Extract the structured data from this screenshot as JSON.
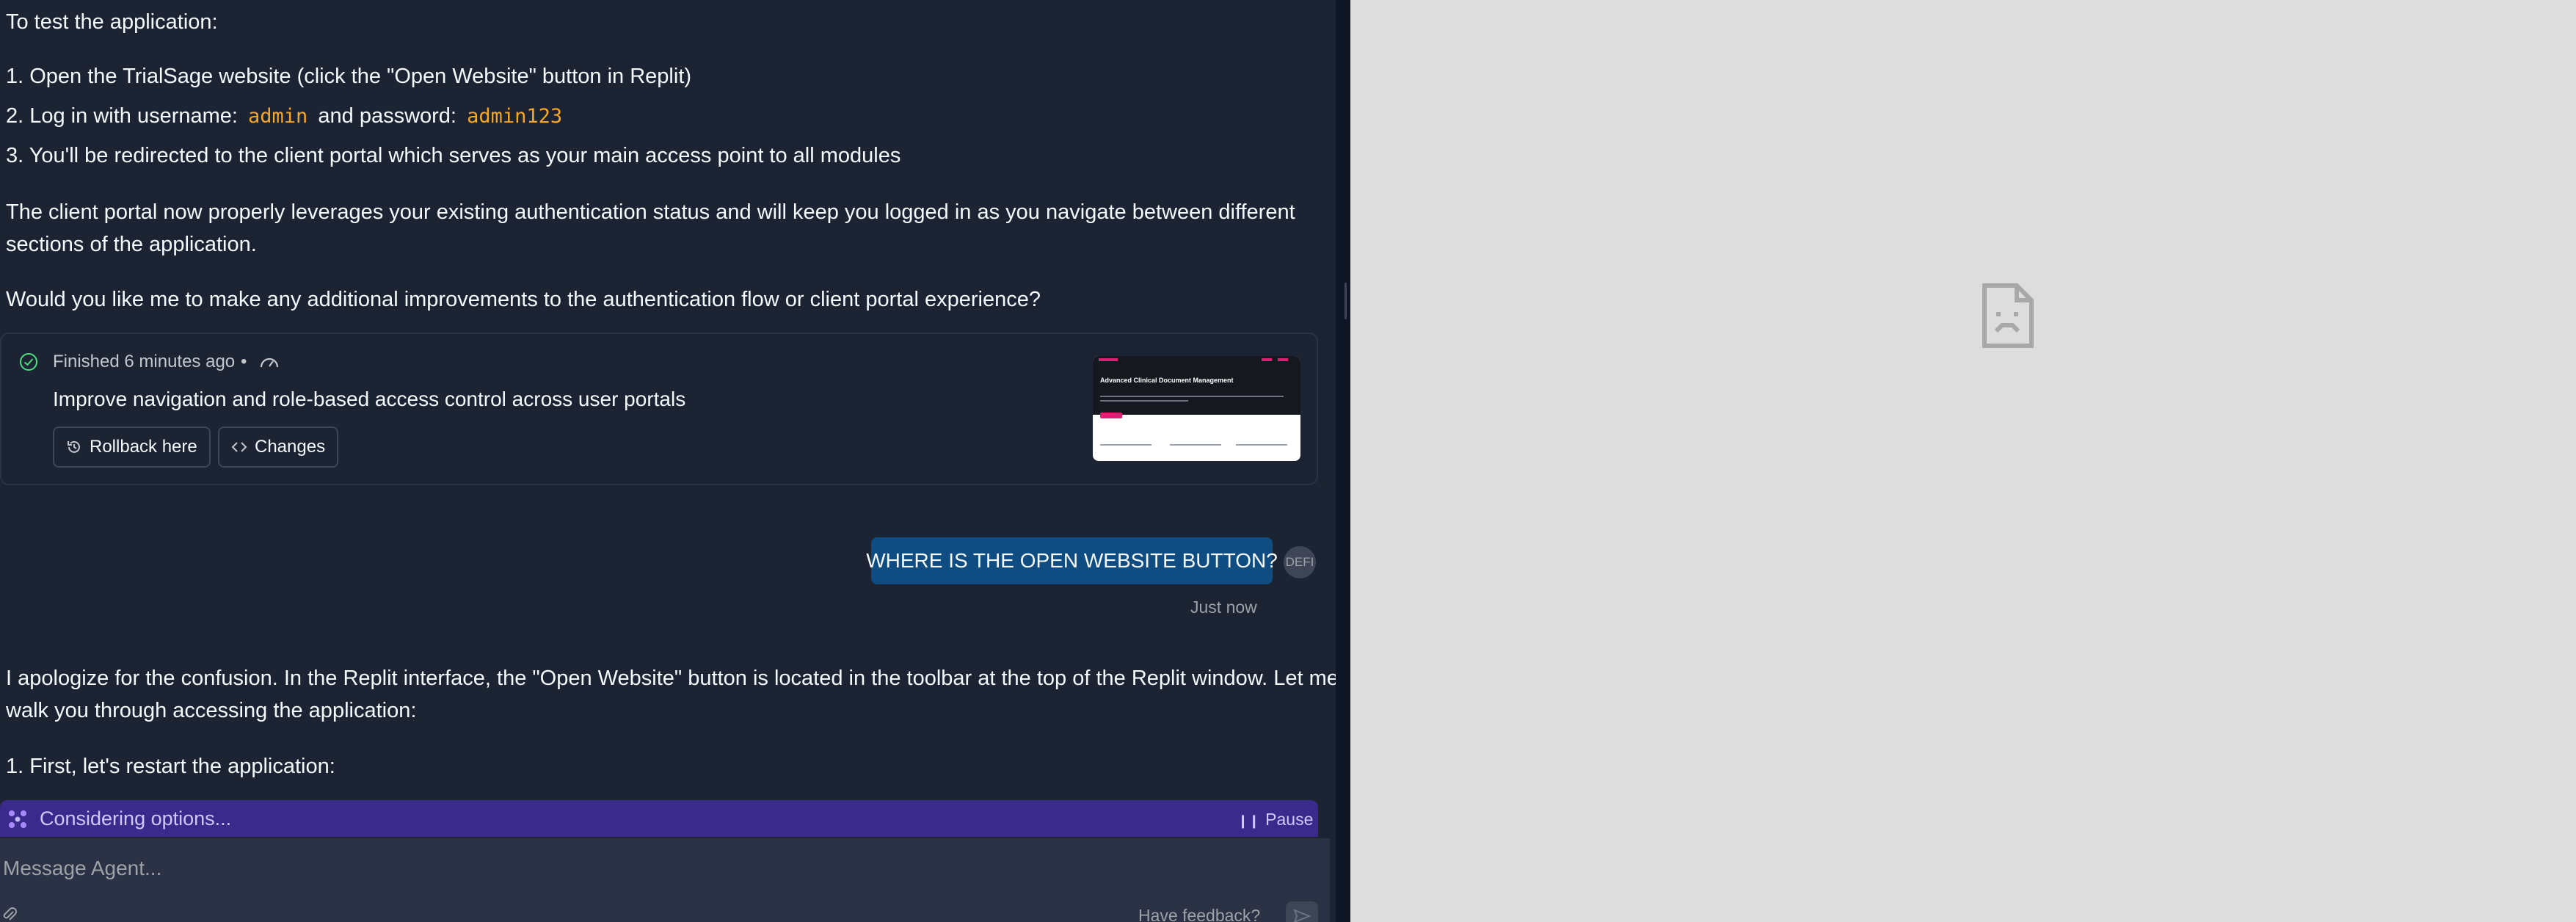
{
  "chat": {
    "intro": "To test the application:",
    "steps": {
      "step1": "1. Open the TrialSage website (click the \"Open Website\" button in Replit)",
      "step2_prefix": "2. Log in with username:",
      "step2_username": "admin",
      "step2_middle": "and password:",
      "step2_password": "admin123",
      "step3": "3. You'll be redirected to the client portal which serves as your main access point to all modules"
    },
    "para_portal_line1": "The client portal now properly leverages your existing authentication status and will keep you logged in as you navigate between different",
    "para_portal_line2": "sections of the application.",
    "para_question": "Would you like me to make any additional improvements to the authentication flow or client portal experience?",
    "checkpoint": {
      "status": "Finished 6 minutes ago",
      "separator": "•",
      "title": "Improve navigation and role-based access control across user portals",
      "rollback_label": "Rollback here",
      "changes_label": "Changes",
      "thumbnail_title": "Advanced Clinical Document Management"
    },
    "user_message": {
      "text": "WHERE IS THE OPEN WEBSITE BUTTON?",
      "avatar_text": "DEFI",
      "timestamp": "Just now"
    },
    "reply": {
      "line1": "I apologize for the confusion. In the Replit interface, the \"Open Website\" button is located in the toolbar at the top of the Replit window. Let me",
      "line2": "walk you through accessing the application:",
      "step1": "1. First, let's restart the application:"
    },
    "agent_status": {
      "text": "Considering options...",
      "pause_label": "Pause"
    },
    "composer": {
      "placeholder": "Message Agent...",
      "feedback_label": "Have feedback?"
    }
  },
  "icons": {
    "check": "check-circle-icon",
    "gauge": "gauge-icon",
    "history": "history-icon",
    "code": "code-icon",
    "agent": "agent-sparkle-icon",
    "pause": "pause-icon",
    "attach": "paperclip-icon",
    "send": "send-icon",
    "preview": "broken-page-icon"
  },
  "colors": {
    "chat_bg": "#1c2333",
    "preview_bg": "#dddddd",
    "user_bubble": "#0f4c81",
    "code_text": "#f5a623",
    "status_bar": "#3a2a8c",
    "input_bg": "#2b3245"
  }
}
